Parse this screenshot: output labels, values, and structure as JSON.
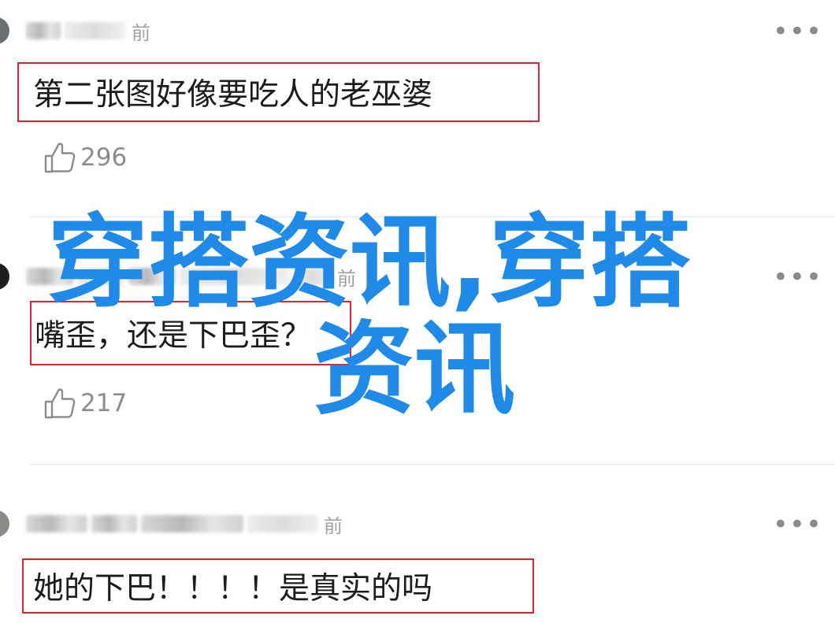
{
  "comments": [
    {
      "time_suffix": "前",
      "text": "第二张图好像要吃人的老巫婆",
      "likes": "296",
      "more": "•••"
    },
    {
      "time_suffix": "前",
      "text": "嘴歪，还是下巴歪？",
      "likes": "217",
      "more": "•••"
    },
    {
      "time_suffix": "前",
      "text": "她的下巴！！！！是真实的吗",
      "more": "•••"
    }
  ],
  "watermark": {
    "line1": "穿搭资讯,穿搭",
    "line2": "资讯"
  },
  "colors": {
    "highlight_border": "#e0242d",
    "watermark": "#1f8ae8",
    "muted_text": "#8c8c8c"
  },
  "icons": {
    "like": "thumbs-up-icon",
    "more": "more-dots-icon"
  }
}
